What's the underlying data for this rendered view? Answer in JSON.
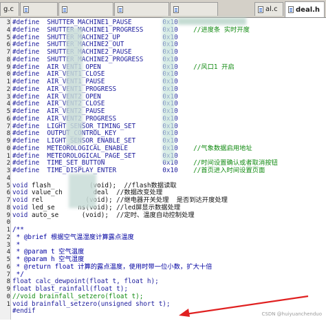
{
  "tabs": [
    {
      "label": "g.c",
      "active": false
    },
    {
      "label": "",
      "active": false
    },
    {
      "label": "",
      "active": false
    },
    {
      "label": "",
      "active": false
    },
    {
      "label": "",
      "active": false
    },
    {
      "label": "al.c",
      "active": false
    },
    {
      "label": "deal.h",
      "active": true
    }
  ],
  "gutter": [
    "3",
    "4",
    "5",
    "6",
    "7",
    "8",
    "9",
    "0",
    "1",
    "2",
    "3",
    "4",
    "5",
    "6",
    "7",
    "8",
    "9",
    "0",
    "1",
    "2",
    "3",
    "4",
    "5",
    "6",
    "7",
    "8",
    "9",
    "0",
    "1",
    "2",
    "3",
    "4",
    "5",
    "6",
    "7",
    "8",
    "9",
    "0",
    "1"
  ],
  "lines": [
    {
      "parts": [
        {
          "t": "#define  SHUTTER_MACHINE1_PAUSE        0x10",
          "c": "kw"
        }
      ]
    },
    {
      "parts": [
        {
          "t": "#define  SHUTTER_MACHINE1_PROGRESS     0x10",
          "c": "kw"
        },
        {
          "t": "    //进度条 实时开度",
          "c": "cm"
        }
      ]
    },
    {
      "parts": [
        {
          "t": "#define  SHUTTER_MACHINE2_UP           0x10",
          "c": "kw"
        }
      ]
    },
    {
      "parts": [
        {
          "t": "#define  SHUTTER_MACHINE2_OUT          0x10",
          "c": "kw"
        }
      ]
    },
    {
      "parts": [
        {
          "t": "#define  SHUTTER_MACHINE2_PAUSE        0x10",
          "c": "kw"
        }
      ]
    },
    {
      "parts": [
        {
          "t": "#define  SHUTTER_MACHINE2_PROGRESS     0x10",
          "c": "kw"
        }
      ]
    },
    {
      "parts": [
        {
          "t": "#define  AIR_VENT1_OPEN                0x10",
          "c": "kw"
        },
        {
          "t": "    //风口1 开启",
          "c": "cm"
        }
      ]
    },
    {
      "parts": [
        {
          "t": "#define  AIR_VENT1_CLOSE               0x10",
          "c": "kw"
        }
      ]
    },
    {
      "parts": [
        {
          "t": "#define  AIR_VENT1_PAUSE               0x10",
          "c": "kw"
        }
      ]
    },
    {
      "parts": [
        {
          "t": "#define  AIR_VENT1_PROGRESS            0x10",
          "c": "kw"
        }
      ]
    },
    {
      "parts": [
        {
          "t": "#define  AIR_VENT2_OPEN                0x10",
          "c": "kw"
        }
      ]
    },
    {
      "parts": [
        {
          "t": "#define  AIR_VENT2_CLOSE               0x10",
          "c": "kw"
        }
      ]
    },
    {
      "parts": [
        {
          "t": "#define  AIR_VENT2_PAUSE               0x10",
          "c": "kw"
        }
      ]
    },
    {
      "parts": [
        {
          "t": "#define  AIR_VENT2_PROGRESS            0x10",
          "c": "kw"
        }
      ]
    },
    {
      "parts": [
        {
          "t": "#define  LIGHT_SENSOR_TIMING_SET       0x10",
          "c": "kw"
        }
      ]
    },
    {
      "parts": [
        {
          "t": "#define  OUTPUT_CONTROL_KEY            0x10",
          "c": "kw"
        }
      ]
    },
    {
      "parts": [
        {
          "t": "#define  LIGHT_SENSOR_ENABLE_SET       0x10",
          "c": "kw"
        }
      ]
    },
    {
      "parts": [
        {
          "t": "#define  METEOROLOGICAL_ENABLE         0x10",
          "c": "kw"
        },
        {
          "t": "    //气象数据启用地址",
          "c": "cm"
        }
      ]
    },
    {
      "parts": [
        {
          "t": "#define  METEOROLOGICAL_PAGE_SET       0x10",
          "c": "kw"
        }
      ]
    },
    {
      "parts": [
        {
          "t": "#define  TIME_SET_BUTTON               0x10",
          "c": "kw"
        },
        {
          "t": "    //时间设置确认或者取消按钮",
          "c": "cm"
        }
      ]
    },
    {
      "parts": [
        {
          "t": "#define  TIME_DISPLAY_ENTER            0x10",
          "c": "kw"
        },
        {
          "t": "    //首页进入时间设置页面",
          "c": "cm"
        }
      ]
    },
    {
      "parts": [
        {
          "t": "",
          "c": "kw"
        }
      ]
    },
    {
      "parts": [
        {
          "t": "void ",
          "c": "kw"
        },
        {
          "t": "flash_         (void);  //flash数据读取",
          "c": "num"
        }
      ]
    },
    {
      "parts": [
        {
          "t": "void ",
          "c": "kw"
        },
        {
          "t": "value_ch        deal  //数据改变处理",
          "c": "num"
        }
      ]
    },
    {
      "parts": [
        {
          "t": "void ",
          "c": "kw"
        },
        {
          "t": "rel           (void); //继电器开关处理  是否到达开度处理",
          "c": "num"
        }
      ]
    },
    {
      "parts": [
        {
          "t": "void ",
          "c": "kw"
        },
        {
          "t": "led_se      ns(void); //led屏显示数据处理",
          "c": "num"
        }
      ]
    },
    {
      "parts": [
        {
          "t": "void ",
          "c": "kw"
        },
        {
          "t": "auto_se      (void);  //定时、温度自动控制处理",
          "c": "num"
        }
      ]
    },
    {
      "parts": [
        {
          "t": "",
          "c": "kw"
        }
      ]
    },
    {
      "parts": [
        {
          "t": "/**",
          "c": "cmt"
        }
      ]
    },
    {
      "parts": [
        {
          "t": " * @brief 根据空气温湿度计算露点温度",
          "c": "cmt"
        }
      ]
    },
    {
      "parts": [
        {
          "t": " *",
          "c": "cmt"
        }
      ]
    },
    {
      "parts": [
        {
          "t": " * @param t 空气温度",
          "c": "cmt"
        }
      ]
    },
    {
      "parts": [
        {
          "t": " * @param h 空气湿度",
          "c": "cmt"
        }
      ]
    },
    {
      "parts": [
        {
          "t": " * @return float 计算的露点温度，使用时带一位小数，扩大十倍",
          "c": "cmt"
        }
      ]
    },
    {
      "parts": [
        {
          "t": " */",
          "c": "cmt"
        }
      ]
    },
    {
      "parts": [
        {
          "t": "float calc_dewpoint(float t, float h);",
          "c": "kw"
        }
      ]
    },
    {
      "parts": [
        {
          "t": "float blast_rainfall(float t);",
          "c": "kw"
        }
      ]
    },
    {
      "parts": [
        {
          "t": "//void brainfall_setzero(float t);",
          "c": "cm"
        }
      ]
    },
    {
      "parts": [
        {
          "t": "void brainfall_setzero(unsigned short t);",
          "c": "kw"
        }
      ]
    },
    {
      "parts": [
        {
          "t": "#endif",
          "c": "kw"
        }
      ]
    }
  ],
  "watermark": "CSDN @huiyuanchenduo",
  "colors": {
    "accent": "#e02020"
  }
}
